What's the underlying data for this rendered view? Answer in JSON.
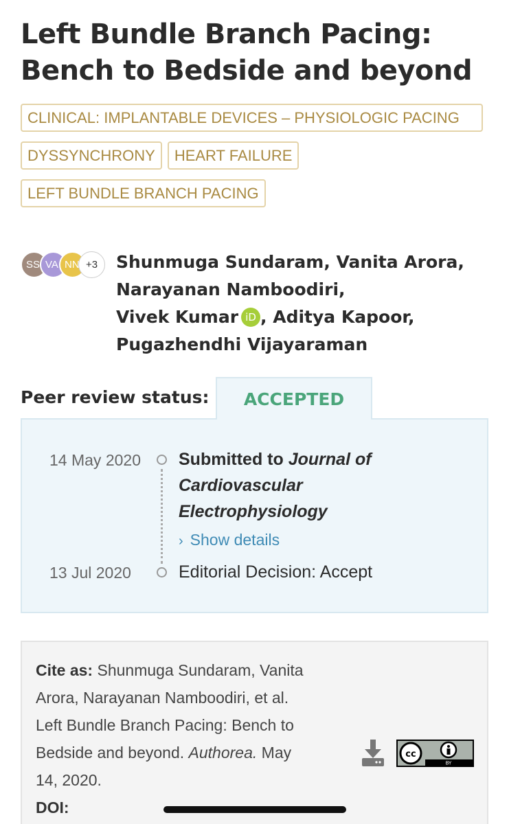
{
  "article": {
    "title_line1": "Left Bundle Branch Pacing:",
    "title_line2": "Bench to Bedside and beyond"
  },
  "tags": [
    "CLINICAL: IMPLANTABLE DEVICES – PHYSIOLOGIC PACING",
    "DYSSYNCHRONY",
    "HEART FAILURE",
    "LEFT BUNDLE BRANCH PACING"
  ],
  "avatars": {
    "items": [
      {
        "initials": "SS",
        "color": "#a08a7d"
      },
      {
        "initials": "VA",
        "color": "#a898d8"
      },
      {
        "initials": "NN",
        "color": "#e8c44a"
      }
    ],
    "more": "+3"
  },
  "authors": {
    "line1": "Shunmuga Sundaram, Vanita Arora,",
    "line2": "Narayanan Namboodiri,",
    "line3a": "Vivek Kumar",
    "orcid": "iD",
    "line3b": ", Aditya Kapoor,",
    "line4": "Pugazhendhi Vijayaraman"
  },
  "peer_review": {
    "label": "Peer review status:",
    "status": "ACCEPTED",
    "events": [
      {
        "date": "14 May 2020",
        "prefix": "Submitted to ",
        "journal_line1": "Journal of",
        "journal_line2": "Cardiovascular",
        "journal_line3": "Electrophysiology"
      },
      {
        "date": "13 Jul 2020",
        "text": "Editorial Decision: Accept"
      }
    ],
    "show_details": "Show details"
  },
  "citation": {
    "label": "Cite as:",
    "line1": " Shunmuga Sundaram, Vanita",
    "line2": "Arora, Narayanan Namboodiri, et al.",
    "line3": "Left Bundle Branch Pacing: Bench to",
    "line4a": "Bedside and beyond. ",
    "journal": "Authorea.",
    "line4b": " May",
    "line5": "14, 2020.",
    "doi_label": "DOI:"
  },
  "license": {
    "cc": "cc",
    "by": "BY"
  },
  "colors": {
    "accent_green": "#4aa57a",
    "tag_gold": "#a98a42",
    "link_blue": "#3f8bb5"
  }
}
